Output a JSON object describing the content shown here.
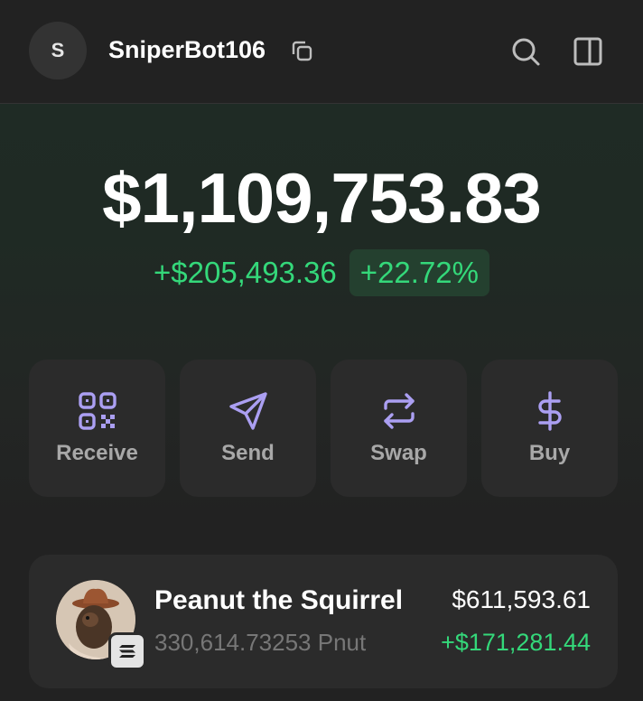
{
  "header": {
    "avatar_letter": "S",
    "account_name": "SniperBot106",
    "icons": [
      "copy-icon",
      "search-icon",
      "sidebar-panel-icon"
    ]
  },
  "balance": {
    "total": "$1,109,753.83",
    "change_amount": "+$205,493.36",
    "change_percent": "+22.72%"
  },
  "actions": [
    {
      "label": "Receive",
      "icon": "qr-code-icon"
    },
    {
      "label": "Send",
      "icon": "send-icon"
    },
    {
      "label": "Swap",
      "icon": "swap-icon"
    },
    {
      "label": "Buy",
      "icon": "dollar-icon"
    }
  ],
  "tokens": [
    {
      "name": "Peanut the Squirrel",
      "amount": "330,614.73253 Pnut",
      "value": "$611,593.61",
      "change": "+$171,281.44",
      "chain_icon": "solana-icon"
    }
  ],
  "colors": {
    "background": "#222222",
    "accent_purple": "#ab9ff2",
    "positive_green": "#34d87a",
    "card": "#2b2b2b"
  }
}
